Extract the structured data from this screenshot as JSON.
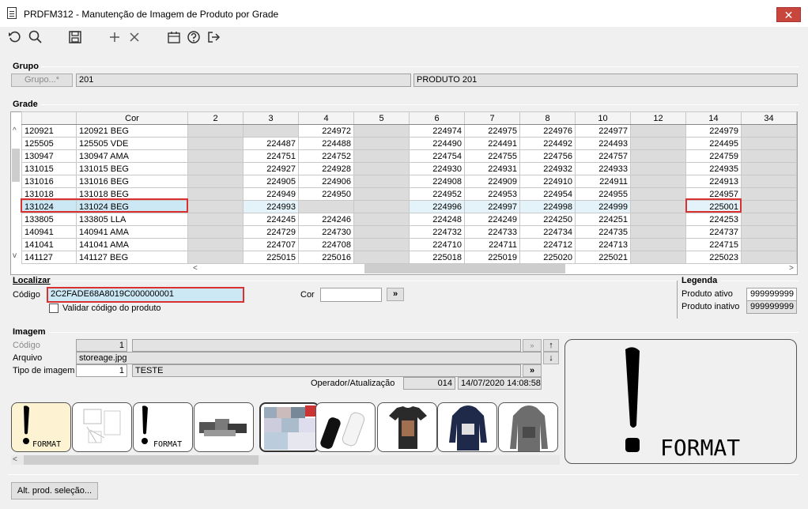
{
  "window": {
    "title": "PRDFM312 - Manutenção de Imagem de Produto por Grade",
    "close_glyph": "✕"
  },
  "toolbar": {
    "icons": [
      "refresh-icon",
      "search-icon",
      "save-icon",
      "add-icon",
      "delete-icon",
      "calendar-icon",
      "help-icon",
      "exit-icon"
    ]
  },
  "grupo": {
    "section": "Grupo",
    "button_label": "Grupo...*",
    "code": "201",
    "description": "PRODUTO 201"
  },
  "grade": {
    "section": "Grade",
    "columns": [
      "",
      "Cor",
      "2",
      "3",
      "4",
      "5",
      "6",
      "7",
      "8",
      "10",
      "12",
      "14",
      "34"
    ],
    "rows": [
      [
        "120921",
        "120921 BEG",
        "",
        "",
        "224972",
        "",
        "224974",
        "224975",
        "224976",
        "224977",
        "",
        "224979",
        ""
      ],
      [
        "125505",
        "125505 VDE",
        "",
        "224487",
        "224488",
        "",
        "224490",
        "224491",
        "224492",
        "224493",
        "",
        "224495",
        ""
      ],
      [
        "130947",
        "130947 AMA",
        "",
        "224751",
        "224752",
        "",
        "224754",
        "224755",
        "224756",
        "224757",
        "",
        "224759",
        ""
      ],
      [
        "131015",
        "131015 BEG",
        "",
        "224927",
        "224928",
        "",
        "224930",
        "224931",
        "224932",
        "224933",
        "",
        "224935",
        ""
      ],
      [
        "131016",
        "131016 BEG",
        "",
        "224905",
        "224906",
        "",
        "224908",
        "224909",
        "224910",
        "224911",
        "",
        "224913",
        ""
      ],
      [
        "131018",
        "131018 BEG",
        "",
        "224949",
        "224950",
        "",
        "224952",
        "224953",
        "224954",
        "224955",
        "",
        "224957",
        ""
      ],
      [
        "131024",
        "131024 BEG",
        "",
        "224993",
        "",
        "",
        "224996",
        "224997",
        "224998",
        "224999",
        "",
        "225001",
        ""
      ],
      [
        "133805",
        "133805 LLA",
        "",
        "224245",
        "224246",
        "",
        "224248",
        "224249",
        "224250",
        "224251",
        "",
        "224253",
        ""
      ],
      [
        "140941",
        "140941 AMA",
        "",
        "224729",
        "224730",
        "",
        "224732",
        "224733",
        "224734",
        "224735",
        "",
        "224737",
        ""
      ],
      [
        "141041",
        "141041 AMA",
        "",
        "224707",
        "224708",
        "",
        "224710",
        "224711",
        "224712",
        "224713",
        "",
        "224715",
        ""
      ],
      [
        "141127",
        "141127 BEG",
        "",
        "225015",
        "225016",
        "",
        "225018",
        "225019",
        "225020",
        "225021",
        "",
        "225023",
        ""
      ]
    ],
    "selected_row_index": 6,
    "selected_cell_value": "225001"
  },
  "localizar": {
    "section": "Localizar",
    "codigo_label": "Código",
    "codigo_value": "2C2FADE68A8019C000000001",
    "cor_label": "Cor",
    "cor_value": "",
    "go_button": "»",
    "validar_label": "Validar código do produto",
    "validar_checked": false
  },
  "legenda": {
    "section": "Legenda",
    "items": [
      {
        "label": "Produto ativo",
        "value": "999999999"
      },
      {
        "label": "Produto inativo",
        "value": "999999999"
      }
    ]
  },
  "imagem": {
    "section": "Imagem",
    "codigo_label": "Código",
    "codigo_value": "1",
    "arquivo_label": "Arquivo",
    "arquivo_value": "storeage.jpg",
    "tipo_label": "Tipo de imagem",
    "tipo_value": "1",
    "tipo_desc": "TESTE",
    "tipo_button": "»",
    "operador_label": "Operador/Atualização",
    "operador_value": "014",
    "timestamp": "14/07/2020 14:08:58",
    "thumb_format_text": "FORMAT",
    "preview_text": "FORMAT",
    "thumbnails": [
      "format-placeholder",
      "sketch-drawing",
      "format-placeholder",
      "shoes-photo",
      "collage-photo",
      "thread-spools-photo",
      "tshirt-photo",
      "hoodie-navy-photo",
      "hoodie-gray-photo"
    ]
  },
  "footer": {
    "alt_button": "Alt. prod. seleção..."
  }
}
